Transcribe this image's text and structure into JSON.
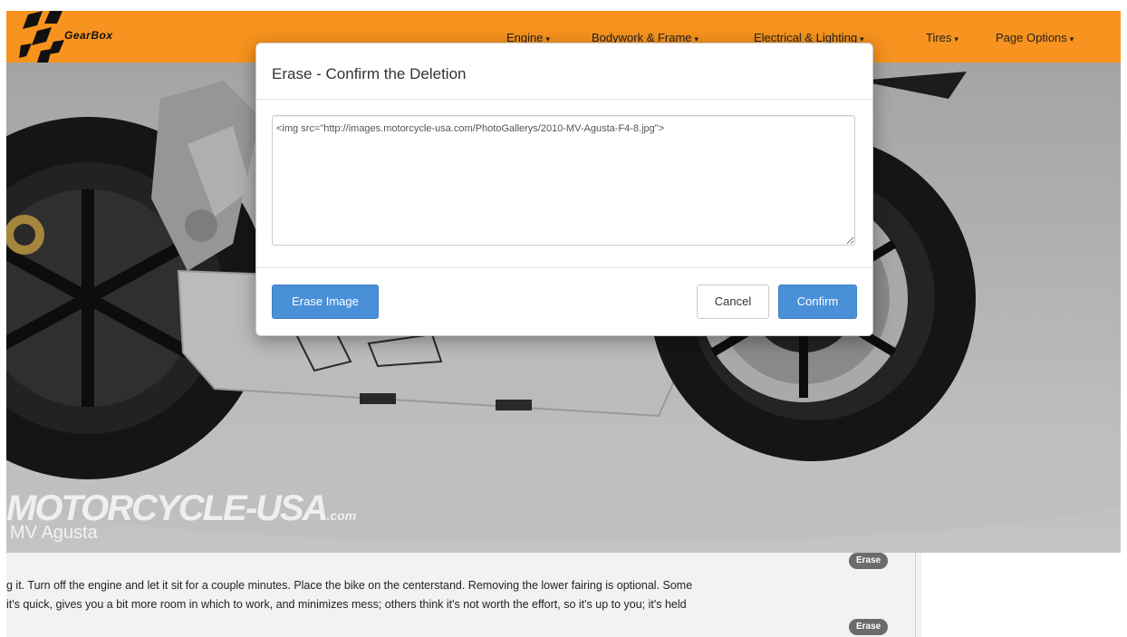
{
  "brand": {
    "name": "GearBox",
    "accent": "#f7931e"
  },
  "nav": {
    "items": [
      {
        "label": "Engine"
      },
      {
        "label": "Bodywork & Frame"
      },
      {
        "label": "Electrical & Lighting"
      },
      {
        "label": "Tires"
      },
      {
        "label": "Page Options"
      }
    ]
  },
  "hero": {
    "watermark": "MOTORCYCLE-USA",
    "watermark_small": ".com",
    "caption": "MV Agusta"
  },
  "content": {
    "line1": "g it. Turn off the engine and let it sit for a couple minutes. Place the bike on the centerstand. Removing the lower fairing is optional. Some",
    "line2": "it's quick, gives you a bit more room in which to work, and minimizes mess; others think it's not worth the effort, so it's up to you; it's held",
    "erase_label_top": "Erase",
    "erase_label_bottom": "Erase"
  },
  "modal": {
    "title": "Erase - Confirm the Deletion",
    "textarea_value": "<img src=\"http://images.motorcycle-usa.com/PhotoGallerys/2010-MV-Agusta-F4-8.jpg\">",
    "erase_image_label": "Erase Image",
    "cancel_label": "Cancel",
    "confirm_label": "Confirm"
  }
}
